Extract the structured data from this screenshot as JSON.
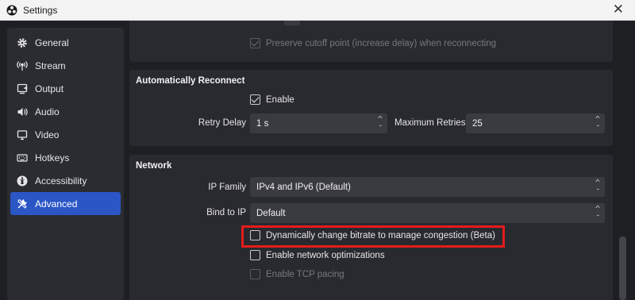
{
  "window": {
    "title": "Settings",
    "close_glyph": "✕"
  },
  "sidebar": {
    "items": [
      {
        "label": "General",
        "icon": "gear-icon"
      },
      {
        "label": "Stream",
        "icon": "broadcast-icon"
      },
      {
        "label": "Output",
        "icon": "output-icon"
      },
      {
        "label": "Audio",
        "icon": "speaker-icon"
      },
      {
        "label": "Video",
        "icon": "monitor-icon"
      },
      {
        "label": "Hotkeys",
        "icon": "keyboard-icon"
      },
      {
        "label": "Accessibility",
        "icon": "accessibility-icon"
      },
      {
        "label": "Advanced",
        "icon": "tools-icon",
        "active": true
      }
    ]
  },
  "top_section": {
    "preserve_cutoff_label": "Preserve cutoff point (increase delay) when reconnecting",
    "preserve_cutoff_checked": true,
    "preserve_cutoff_disabled": true
  },
  "reconnect": {
    "title": "Automatically Reconnect",
    "enable_label": "Enable",
    "enable_checked": true,
    "retry_delay_label": "Retry Delay",
    "retry_delay_value": "1 s",
    "max_retries_label": "Maximum Retries",
    "max_retries_value": "25"
  },
  "network": {
    "title": "Network",
    "ip_family_label": "IP Family",
    "ip_family_value": "IPv4 and IPv6 (Default)",
    "bind_to_ip_label": "Bind to IP",
    "bind_to_ip_value": "Default",
    "dynamic_bitrate_label": "Dynamically change bitrate to manage congestion (Beta)",
    "dynamic_bitrate_checked": false,
    "network_opt_label": "Enable network optimizations",
    "network_opt_checked": false,
    "tcp_pacing_label": "Enable TCP pacing",
    "tcp_pacing_checked": false,
    "tcp_pacing_disabled": true
  },
  "colors": {
    "accent": "#2a56c6",
    "highlight": "#e41b1b",
    "panel": "#292a2f",
    "background": "#1e1f23"
  }
}
